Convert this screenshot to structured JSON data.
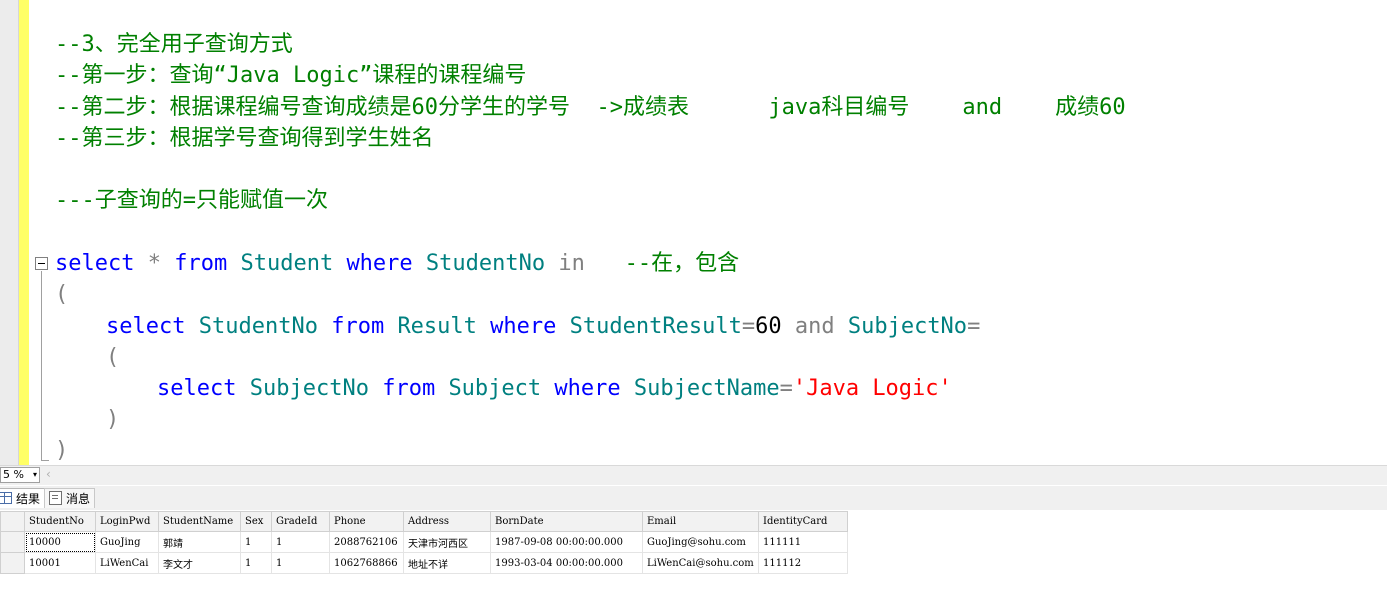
{
  "editor": {
    "lines": {
      "c1": "--3、完全用子查询方式",
      "c2": "--第一步：查询“Java Logic”课程的课程编号",
      "c3": "--第二步：根据课程编号查询成绩是60分学生的学号  ->成绩表      java科目编号    and    成绩60",
      "c4": "--第三步：根据学号查询得到学生姓名",
      "c5": "---子查询的=只能赋值一次",
      "q1": {
        "kw1": "select",
        "star": "*",
        "kw2": "from",
        "tbl": "Student",
        "kw3": "where",
        "col": "StudentNo",
        "kw4": "in",
        "cm": "--在，包含"
      },
      "p1": "(",
      "q2": {
        "kw1": "select",
        "col1": "StudentNo",
        "kw2": "from",
        "tbl": "Result",
        "kw3": "where",
        "col2": "StudentResult",
        "eq": "=",
        "num": "60",
        "and": "and",
        "col3": "SubjectNo",
        "eq2": "="
      },
      "p2": "(",
      "q3": {
        "kw1": "select",
        "col1": "SubjectNo",
        "kw2": "from",
        "tbl": "Subject",
        "kw3": "where",
        "col2": "SubjectName",
        "eq": "=",
        "str": "'Java Logic'"
      },
      "p3": ")",
      "p4": ")"
    }
  },
  "statusbar": {
    "zoom": "5 %",
    "zoom_arrow": "▾",
    "scroll_left": "‹"
  },
  "tabs": {
    "results": "结果",
    "messages": "消息"
  },
  "grid": {
    "columns": [
      "StudentNo",
      "LoginPwd",
      "StudentName",
      "Sex",
      "GradeId",
      "Phone",
      "Address",
      "BornDate",
      "Email",
      "IdentityCard"
    ],
    "rows": [
      [
        "10000",
        "GuoJing",
        "郭靖",
        "1",
        "1",
        "2088762106",
        "天津市河西区",
        "1987-09-08 00:00:00.000",
        "GuoJing@sohu.com",
        "111111"
      ],
      [
        "10001",
        "LiWenCai",
        "李文才",
        "1",
        "1",
        "1062768866",
        "地址不详",
        "1993-03-04 00:00:00.000",
        "LiWenCai@sohu.com",
        "111112"
      ]
    ]
  },
  "colors": {
    "comment": "#008000",
    "keyword": "#0000ff",
    "identifier": "#008080",
    "string": "#ff0000",
    "operator": "#808080"
  }
}
